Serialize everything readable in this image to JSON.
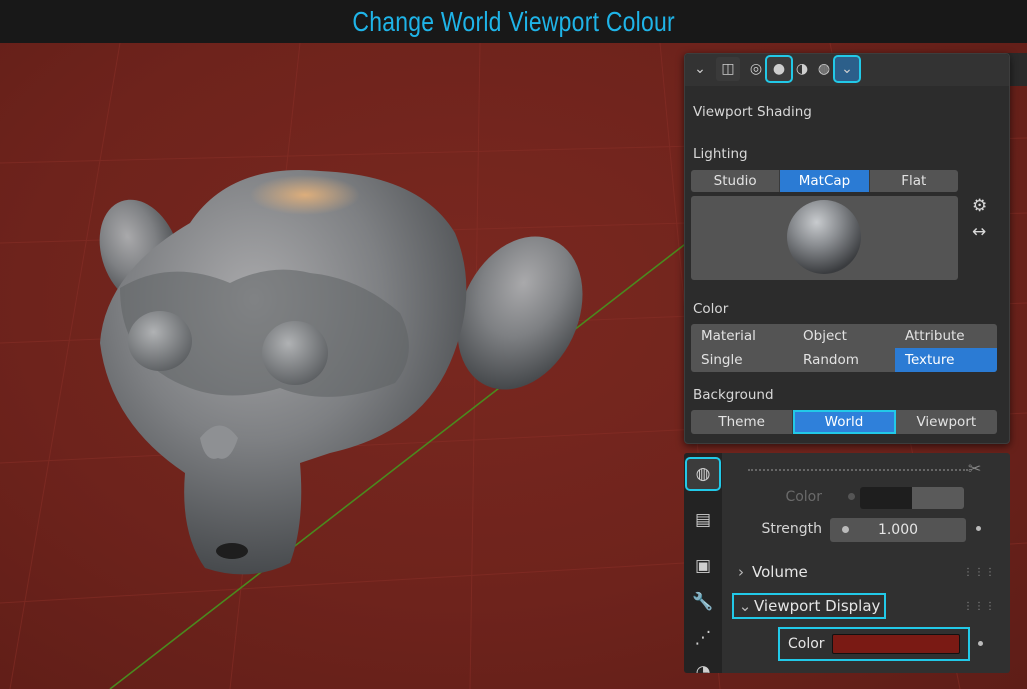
{
  "title": "Change World Viewport Colour",
  "shading_popover": {
    "header_icons": [
      "chevron-down-icon",
      "xray-icon",
      "wireframe-icon",
      "solid-icon",
      "material-preview-icon",
      "rendered-icon",
      "chevron-down-icon"
    ],
    "heading": "Viewport Shading",
    "lighting": {
      "label": "Lighting",
      "options": [
        "Studio",
        "MatCap",
        "Flat"
      ],
      "selected": "MatCap"
    },
    "color": {
      "label": "Color",
      "options": [
        "Material",
        "Object",
        "Attribute",
        "Single",
        "Random",
        "Texture"
      ],
      "selected": "Texture"
    },
    "background": {
      "label": "Background",
      "options": [
        "Theme",
        "World",
        "Viewport"
      ],
      "selected": "World"
    }
  },
  "outliner_icons": [
    "outliner-display-mode-icon",
    "filter-icon",
    "search-icon"
  ],
  "properties": {
    "tabs": [
      "world-icon",
      "collection-icon",
      "object-icon",
      "wrench-icon",
      "vertex-icon",
      "physics-icon"
    ],
    "color_label": "Color",
    "strength_label": "Strength",
    "strength_value": "1.000",
    "volume_label": "Volume",
    "viewport_display_label": "Viewport Display",
    "viewport_color_label": "Color",
    "viewport_color": "#7a1a14"
  },
  "colors": {
    "accent_blue": "#2b7bd4",
    "highlight_cyan": "#22c9e8",
    "title_cyan": "#1fb4e8",
    "viewport_background": "#6e231c"
  }
}
